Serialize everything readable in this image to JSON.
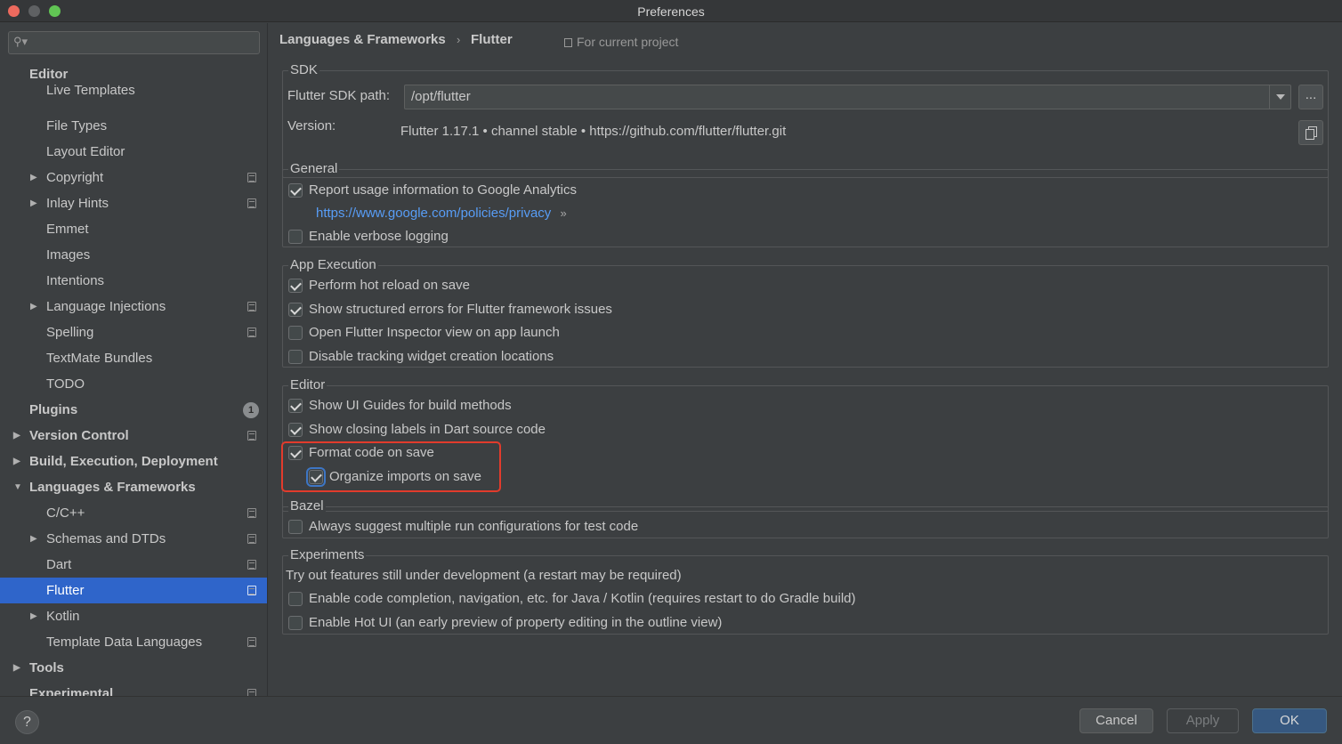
{
  "window": {
    "title": "Preferences"
  },
  "sidebar": {
    "search_placeholder": "",
    "items": [
      {
        "label": "Editor",
        "bold": true,
        "indent": 0,
        "arrow": "",
        "proj": false
      },
      {
        "label": "Live Templates",
        "bold": false,
        "indent": 1,
        "arrow": "",
        "proj": false
      },
      {
        "label": "File Types",
        "bold": false,
        "indent": 1,
        "arrow": "",
        "proj": false
      },
      {
        "label": "Layout Editor",
        "bold": false,
        "indent": 1,
        "arrow": "",
        "proj": false
      },
      {
        "label": "Copyright",
        "bold": false,
        "indent": 1,
        "arrow": "▶",
        "proj": true
      },
      {
        "label": "Inlay Hints",
        "bold": false,
        "indent": 1,
        "arrow": "▶",
        "proj": true
      },
      {
        "label": "Emmet",
        "bold": false,
        "indent": 1,
        "arrow": "",
        "proj": false
      },
      {
        "label": "Images",
        "bold": false,
        "indent": 1,
        "arrow": "",
        "proj": false
      },
      {
        "label": "Intentions",
        "bold": false,
        "indent": 1,
        "arrow": "",
        "proj": false
      },
      {
        "label": "Language Injections",
        "bold": false,
        "indent": 1,
        "arrow": "▶",
        "proj": true
      },
      {
        "label": "Spelling",
        "bold": false,
        "indent": 1,
        "arrow": "",
        "proj": true
      },
      {
        "label": "TextMate Bundles",
        "bold": false,
        "indent": 1,
        "arrow": "",
        "proj": false
      },
      {
        "label": "TODO",
        "bold": false,
        "indent": 1,
        "arrow": "",
        "proj": false
      },
      {
        "label": "Plugins",
        "bold": true,
        "indent": 0,
        "arrow": "",
        "proj": false,
        "badge": "1"
      },
      {
        "label": "Version Control",
        "bold": true,
        "indent": 0,
        "arrow": "▶",
        "proj": true
      },
      {
        "label": "Build, Execution, Deployment",
        "bold": true,
        "indent": 0,
        "arrow": "▶",
        "proj": false
      },
      {
        "label": "Languages & Frameworks",
        "bold": true,
        "indent": 0,
        "arrow": "▼",
        "proj": false
      },
      {
        "label": "C/C++",
        "bold": false,
        "indent": 1,
        "arrow": "",
        "proj": true
      },
      {
        "label": "Schemas and DTDs",
        "bold": false,
        "indent": 1,
        "arrow": "▶",
        "proj": true
      },
      {
        "label": "Dart",
        "bold": false,
        "indent": 1,
        "arrow": "",
        "proj": true
      },
      {
        "label": "Flutter",
        "bold": false,
        "indent": 1,
        "arrow": "",
        "proj": true,
        "selected": true
      },
      {
        "label": "Kotlin",
        "bold": false,
        "indent": 1,
        "arrow": "▶",
        "proj": false
      },
      {
        "label": "Template Data Languages",
        "bold": false,
        "indent": 1,
        "arrow": "",
        "proj": true
      },
      {
        "label": "Tools",
        "bold": true,
        "indent": 0,
        "arrow": "▶",
        "proj": false
      },
      {
        "label": "Experimental",
        "bold": true,
        "indent": 0,
        "arrow": "",
        "proj": true
      }
    ]
  },
  "breadcrumb": {
    "parent": "Languages & Frameworks",
    "separator": "›",
    "current": "Flutter",
    "scope": "For current project"
  },
  "sdk": {
    "title": "SDK",
    "path_label": "Flutter SDK path:",
    "path_value": "/opt/flutter",
    "browse_label": "...",
    "version_label": "Version:",
    "version_value": "Flutter 1.17.1 • channel stable • https://github.com/flutter/flutter.git"
  },
  "general": {
    "title": "General",
    "report_usage": {
      "label": "Report usage information to Google Analytics",
      "checked": true
    },
    "privacy_link": "https://www.google.com/policies/privacy",
    "privacy_arrow": "»",
    "verbose": {
      "label": "Enable verbose logging",
      "checked": false
    }
  },
  "app_execution": {
    "title": "App Execution",
    "items": [
      {
        "label": "Perform hot reload on save",
        "checked": true
      },
      {
        "label": "Show structured errors for Flutter framework issues",
        "checked": true
      },
      {
        "label": "Open Flutter Inspector view on app launch",
        "checked": false
      },
      {
        "label": "Disable tracking widget creation locations",
        "checked": false
      }
    ]
  },
  "editor": {
    "title": "Editor",
    "items": [
      {
        "label": "Show UI Guides for build methods",
        "checked": true
      },
      {
        "label": "Show closing labels in Dart source code",
        "checked": true
      },
      {
        "label": "Format code on save",
        "checked": true
      },
      {
        "label": "Organize imports on save",
        "checked": true
      }
    ]
  },
  "bazel": {
    "title": "Bazel",
    "items": [
      {
        "label": "Always suggest multiple run configurations for test code",
        "checked": false
      }
    ]
  },
  "experiments": {
    "title": "Experiments",
    "note": "Try out features still under development (a restart may be required)",
    "items": [
      {
        "label": "Enable code completion, navigation, etc. for Java / Kotlin (requires restart to do Gradle build)",
        "checked": false
      },
      {
        "label": "Enable Hot UI (an early preview of property editing in the outline view)",
        "checked": false
      }
    ]
  },
  "footer": {
    "help": "?",
    "cancel": "Cancel",
    "apply": "Apply",
    "ok": "OK"
  },
  "colors": {
    "accent": "#2f65ca",
    "highlight": "#e23b2c",
    "link": "#589df6",
    "ok_button": "#365880"
  }
}
